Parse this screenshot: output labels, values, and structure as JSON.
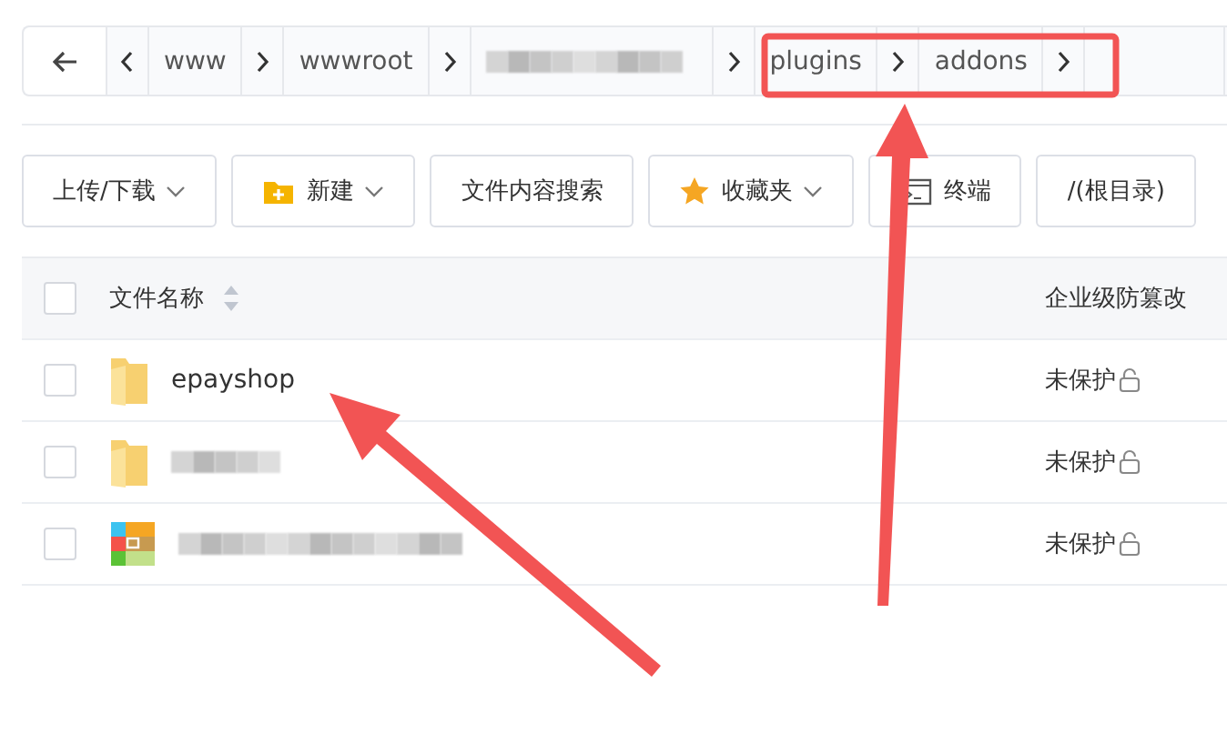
{
  "breadcrumb": [
    {
      "label": "www",
      "blurred": false
    },
    {
      "label": "wwwroot",
      "blurred": false
    },
    {
      "blurred": true
    },
    {
      "label": "plugins",
      "blurred": false
    },
    {
      "label": "addons",
      "blurred": false
    }
  ],
  "toolbar": [
    {
      "label": "上传/下载",
      "kind": "plain",
      "dropdown": true
    },
    {
      "label": "新建",
      "kind": "folder",
      "dropdown": true
    },
    {
      "label": "文件内容搜索",
      "kind": "plain",
      "dropdown": false
    },
    {
      "label": "收藏夹",
      "kind": "star",
      "dropdown": true
    },
    {
      "label": "终端",
      "kind": "terminal",
      "dropdown": false
    },
    {
      "label": "/(根目录)",
      "kind": "plain",
      "dropdown": false
    }
  ],
  "table": {
    "columns": [
      "文件名称",
      "企业级防篡改"
    ],
    "all_checked": false,
    "rows": [
      {
        "kind": "folder",
        "name": "epayshop",
        "blurred": false,
        "checked": false,
        "protection": "未保护"
      },
      {
        "kind": "folder",
        "blurred": true,
        "checked": false,
        "protection": "未保护"
      },
      {
        "kind": "archive",
        "blurred": true,
        "checked": false,
        "protection": "未保护"
      }
    ]
  }
}
